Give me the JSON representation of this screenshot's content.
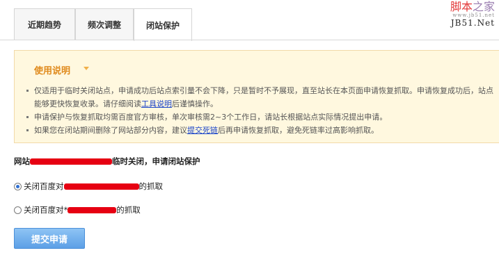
{
  "tabs": [
    {
      "label": "近期趋势"
    },
    {
      "label": "频次调整"
    },
    {
      "label": "闭站保护",
      "active": true
    }
  ],
  "watermark": {
    "top_a": "脚本",
    "top_b": "之家",
    "sub": "www.jb51.net",
    "bottom": "JB51.Net"
  },
  "notice": {
    "title": "使用说明",
    "items": [
      {
        "text": "仅适用于临时关闭站点，申请成功后站点索引量不会下降，只是暂时不予展现，直至站长在本页面申请恢复抓取。申请恢复成功后，站点能够更快恢复收录。请仔细阅读",
        "link": "工具说明",
        "after": "后谨慎操作。"
      },
      {
        "text": "申请保护与恢复抓取均需百度官方审核，单次审核需2~3个工作日，请站长根据站点实际情况提出申请。",
        "link": "",
        "after": ""
      },
      {
        "text": "如果您在闭站期间删除了网站部分内容，建议",
        "link": "提交死链",
        "after": "后再申请恢复抓取，避免死链率过高影响抓取。"
      }
    ]
  },
  "site_line": {
    "prefix": "网站",
    "suffix": "临时关闭，申请闭站保护"
  },
  "options": [
    {
      "prefix": "关闭百度对",
      "suffix": "的抓取",
      "checked": true
    },
    {
      "prefix": "关闭百度对*",
      "suffix": "的抓取",
      "checked": false
    }
  ],
  "submit_label": "提交申请",
  "colors": {
    "notice_bg": "#fff8df",
    "notice_title": "#e08a1c",
    "redaction": "#e60012",
    "button": "#5c9fe6"
  }
}
